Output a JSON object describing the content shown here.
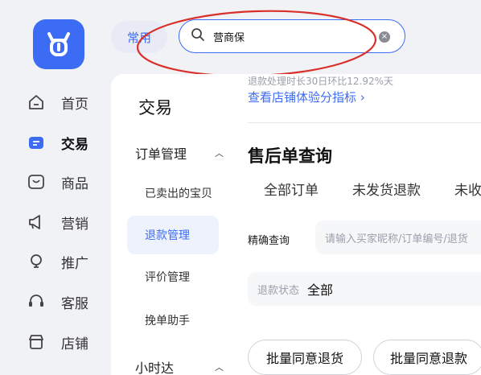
{
  "rail": {
    "items": [
      {
        "icon": "home-icon",
        "label": "首页"
      },
      {
        "icon": "trade-icon",
        "label": "交易"
      },
      {
        "icon": "goods-icon",
        "label": "商品"
      },
      {
        "icon": "marketing-icon",
        "label": "营销"
      },
      {
        "icon": "promotion-icon",
        "label": "推广"
      },
      {
        "icon": "customer-service-icon",
        "label": "客服"
      },
      {
        "icon": "store-icon",
        "label": "店铺"
      }
    ],
    "active_index": 1
  },
  "topbar": {
    "changyong_label": "常用",
    "search_value": "营商保"
  },
  "submenu": {
    "title": "交易",
    "group1": "订单管理",
    "items": [
      "已卖出的宝贝",
      "退款管理",
      "评价管理",
      "挽单助手"
    ],
    "active_item": "退款管理",
    "group2": "小时达"
  },
  "main": {
    "notice": "退款处理时长30日环比12.92%天",
    "notice_link": "查看店铺体验分指标 ›",
    "page_title": "售后单查询",
    "tabs": [
      "全部订单",
      "未发货退款",
      "未收"
    ],
    "search_label": "精确查询",
    "search_placeholder": "请输入买家昵称/订单编号/退货",
    "status_key": "退款状态",
    "status_value": "全部",
    "btn_agree_return": "批量同意退货",
    "btn_agree_refund": "批量同意退款"
  },
  "colors": {
    "accent": "#3d6cf4",
    "annotation": "#d9302b"
  }
}
